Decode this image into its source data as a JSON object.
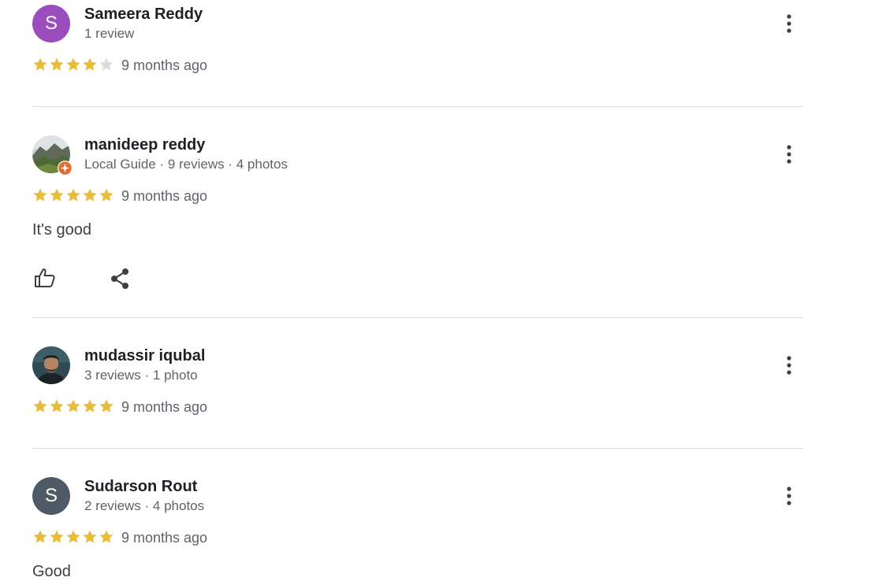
{
  "colors": {
    "star_filled": "#e9bc3b",
    "star_empty": "#dadce0",
    "avatar_purple": "#9c4dbd",
    "avatar_slate": "#4e5b66",
    "local_guide_badge": "#e06d2f"
  },
  "reviews": [
    {
      "initial": "S",
      "name": "Sameera Reddy",
      "meta": "1 review",
      "rating": 4,
      "date": "9 months ago",
      "text": ""
    },
    {
      "initial": "",
      "name": "manideep reddy",
      "meta": "Local Guide · 9 reviews · 4 photos",
      "rating": 5,
      "date": "9 months ago",
      "text": "It's good"
    },
    {
      "initial": "",
      "name": "mudassir iqubal",
      "meta": "3 reviews · 1 photo",
      "rating": 5,
      "date": "9 months ago",
      "text": ""
    },
    {
      "initial": "S",
      "name": "Sudarson Rout",
      "meta": "2 reviews · 4 photos",
      "rating": 5,
      "date": "9 months ago",
      "text": "Good"
    }
  ]
}
